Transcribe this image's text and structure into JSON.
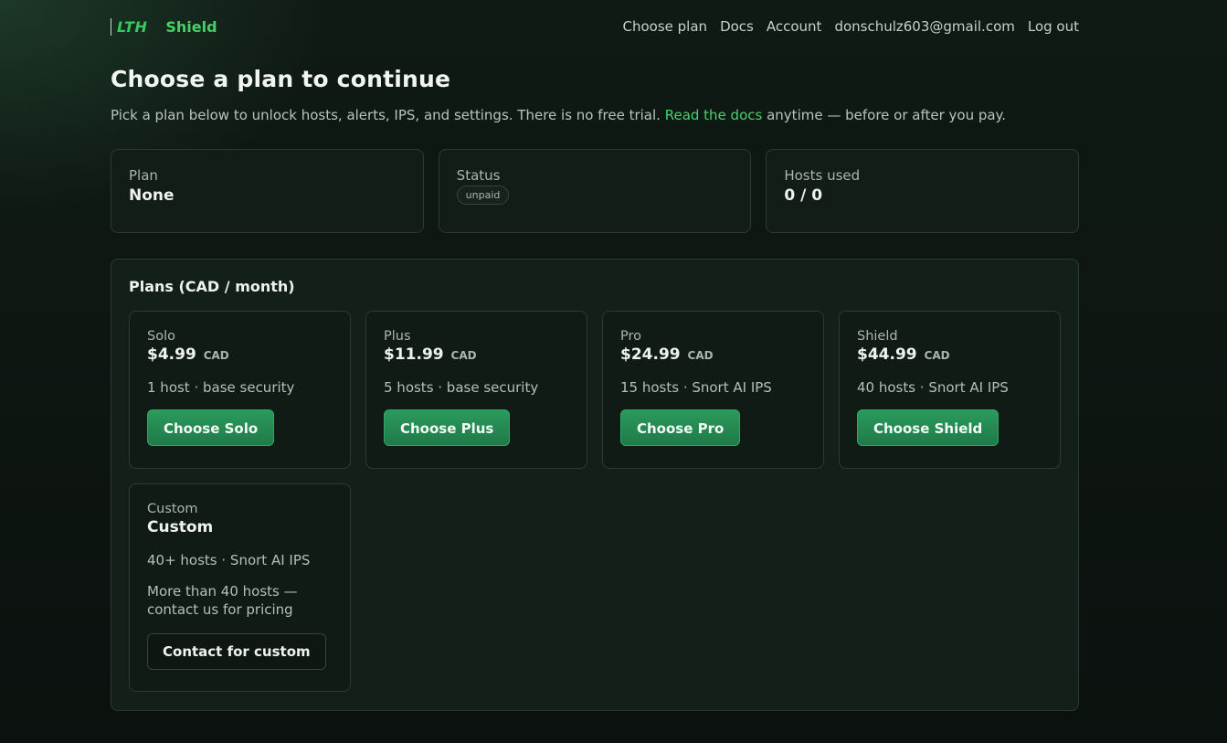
{
  "brand": {
    "mark": "LTH",
    "name": "Shield"
  },
  "nav": [
    "Choose plan",
    "Docs",
    "Account",
    "donschulz603@gmail.com",
    "Log out"
  ],
  "page": {
    "title": "Choose a plan to continue",
    "subtitle_before": "Pick a plan below to unlock hosts, alerts, IPS, and settings. There is no free trial.",
    "subtitle_link": "Read the docs",
    "subtitle_after": "anytime — before or after you pay."
  },
  "stats": {
    "plan": {
      "label": "Plan",
      "value": "None"
    },
    "status": {
      "label": "Status",
      "value": "unpaid"
    },
    "hosts": {
      "label": "Hosts used",
      "value": "0 / 0"
    }
  },
  "plans_panel": {
    "title": "Plans (CAD / month)",
    "plans": [
      {
        "name": "Solo",
        "price": "$4.99",
        "currency": "CAD",
        "desc": "1 host · base security",
        "button": "Choose Solo"
      },
      {
        "name": "Plus",
        "price": "$11.99",
        "currency": "CAD",
        "desc": "5 hosts · base security",
        "button": "Choose Plus"
      },
      {
        "name": "Pro",
        "price": "$24.99",
        "currency": "CAD",
        "desc": "15 hosts · Snort AI IPS",
        "button": "Choose Pro"
      },
      {
        "name": "Shield",
        "price": "$44.99",
        "currency": "CAD",
        "desc": "40 hosts · Snort AI IPS",
        "button": "Choose Shield"
      }
    ],
    "custom": {
      "name": "Custom",
      "price": "Custom",
      "desc": "40+ hosts · Snort AI IPS",
      "note": "More than 40 hosts — contact us for pricing",
      "button": "Contact for custom"
    }
  }
}
